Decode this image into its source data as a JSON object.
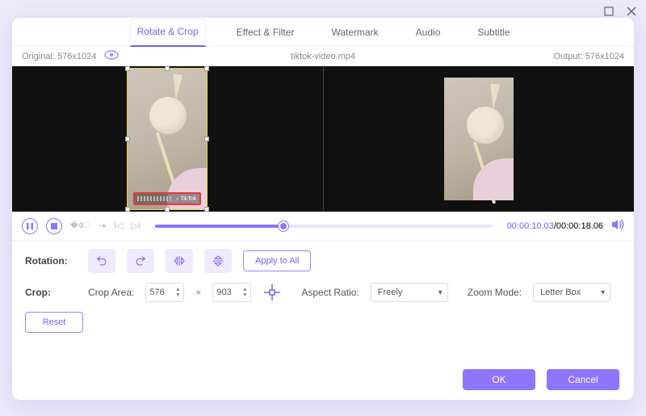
{
  "window": {
    "file_name": "tiktok-video.mp4"
  },
  "tabs": [
    "Rotate & Crop",
    "Effect & Filter",
    "Watermark",
    "Audio",
    "Subtitle"
  ],
  "active_tab": 0,
  "meta": {
    "original_label": "Original: 576x1024",
    "output_label": "Output: 576x1024"
  },
  "watermark_text": "TikTok",
  "playback": {
    "current": "00:00:10.03",
    "total": "00:00:18.06"
  },
  "rotation": {
    "label": "Rotation:",
    "apply_all": "Apply to All",
    "buttons": [
      "rotate-left",
      "rotate-right",
      "flip-horizontal",
      "flip-vertical"
    ]
  },
  "crop": {
    "label": "Crop:",
    "area_label": "Crop Area:",
    "width": "576",
    "height": "903",
    "aspect_label": "Aspect Ratio:",
    "aspect_value": "Freely",
    "zoom_label": "Zoom Mode:",
    "zoom_value": "Letter Box",
    "reset": "Reset"
  },
  "footer": {
    "ok": "OK",
    "cancel": "Cancel"
  },
  "colors": {
    "accent": "#8e74ff"
  }
}
